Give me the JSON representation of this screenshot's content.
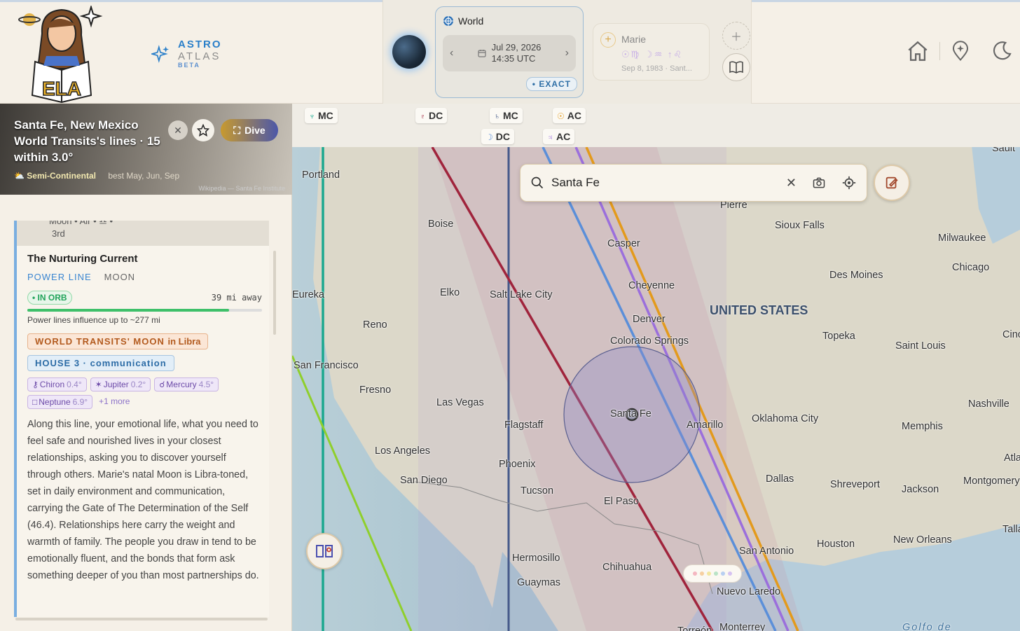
{
  "brand": {
    "line1": "ASTRO",
    "line2": "ATLAS",
    "tag": "BETA",
    "logo_text": "ELA"
  },
  "world": {
    "title": "World",
    "date": "Jul 29, 2026",
    "time": "14:35 UTC",
    "exact_label": "• EXACT"
  },
  "person": {
    "name": "Marie",
    "details": "Sep 8, 1983 · Sant..."
  },
  "location": {
    "title": "Santa Fe, New Mexico",
    "subtitle": "World Transits's lines · 15 within 3.0°",
    "climate": "Semi-Continental",
    "best": "best May, Jun, Sep",
    "credit": "Wikipedia — Santa Fe Institute",
    "dive_label": "Dive"
  },
  "prev_item": {
    "line1": "Moon  •  Air  •  ♎  •",
    "line2": "3rd"
  },
  "line_card": {
    "title": "The Nurturing Current",
    "kind": "POWER LINE",
    "planet": "MOON",
    "orb_status": "• IN ORB",
    "distance": "39 mi away",
    "orb_fraction": 0.86,
    "influence_note": "Power lines influence up to ~277 mi",
    "transit_tag": "WORLD TRANSITS' MOON",
    "transit_sign": "in Libra",
    "house_tag": "HOUSE 3 · communication",
    "aspects": [
      {
        "symbol": "⚷",
        "name": "Chiron",
        "orb": "0.4°"
      },
      {
        "symbol": "✶",
        "name": "Jupiter",
        "orb": "0.2°"
      },
      {
        "symbol": "☌",
        "name": "Mercury",
        "orb": "4.5°"
      },
      {
        "symbol": "□",
        "name": "Neptune",
        "orb": "6.9°"
      }
    ],
    "more": "+1 more",
    "description": "Along this line, your emotional life, what you need to feel safe and nourished lives in your closest relationships, asking you to discover yourself through others. Marie's natal Moon is Libra-toned, set in daily environment and communication, carrying the Gate of The Determination of the Self (46.4). Relationships here carry the weight and warmth of family. The people you draw in tend to be emotionally fluent, and the bonds that form ask something deeper of you than most partnerships do."
  },
  "map": {
    "search_value": "Santa Fe",
    "line_labels": [
      {
        "glyph": "♆",
        "angle": "MC",
        "color": "#1ba88f"
      },
      {
        "glyph": "♇",
        "angle": "DC",
        "color": "#a0243c"
      },
      {
        "glyph": "♄",
        "angle": "MC",
        "color": "#45598a"
      },
      {
        "glyph": "☉",
        "angle": "AC",
        "color": "#e39a1c"
      },
      {
        "glyph": "☽",
        "angle": "DC",
        "color": "#5b8fd9"
      },
      {
        "glyph": "♃",
        "angle": "AC",
        "color": "#9b6fdc"
      }
    ],
    "country": "UNITED STATES",
    "cities": [
      "Portland",
      "Boise",
      "Elko",
      "Salt Lake City",
      "Casper",
      "Cheyenne",
      "Denver",
      "Colorado Springs",
      "Reno",
      "San Francisco",
      "Fresno",
      "Las Vegas",
      "Flagstaff",
      "Los Angeles",
      "San Diego",
      "Phoenix",
      "Tucson",
      "El Paso",
      "Santa Fe",
      "Amarillo",
      "Oklahoma City",
      "Dallas",
      "Shreveport",
      "Jackson",
      "Montgomery",
      "Memphis",
      "Nashville",
      "Saint Louis",
      "Topeka",
      "Des Moines",
      "Chicago",
      "Milwaukee",
      "Sioux Falls",
      "Pierre",
      "San Antonio",
      "Houston",
      "New Orleans",
      "Hermosillo",
      "Chihuahua",
      "Guaymas",
      "Nuevo Laredo",
      "Monterrey",
      "Torreón",
      "Eureka",
      "Cincinnati",
      "Atlanta",
      "Tallahassee",
      "Sault",
      "Golfo de"
    ]
  }
}
